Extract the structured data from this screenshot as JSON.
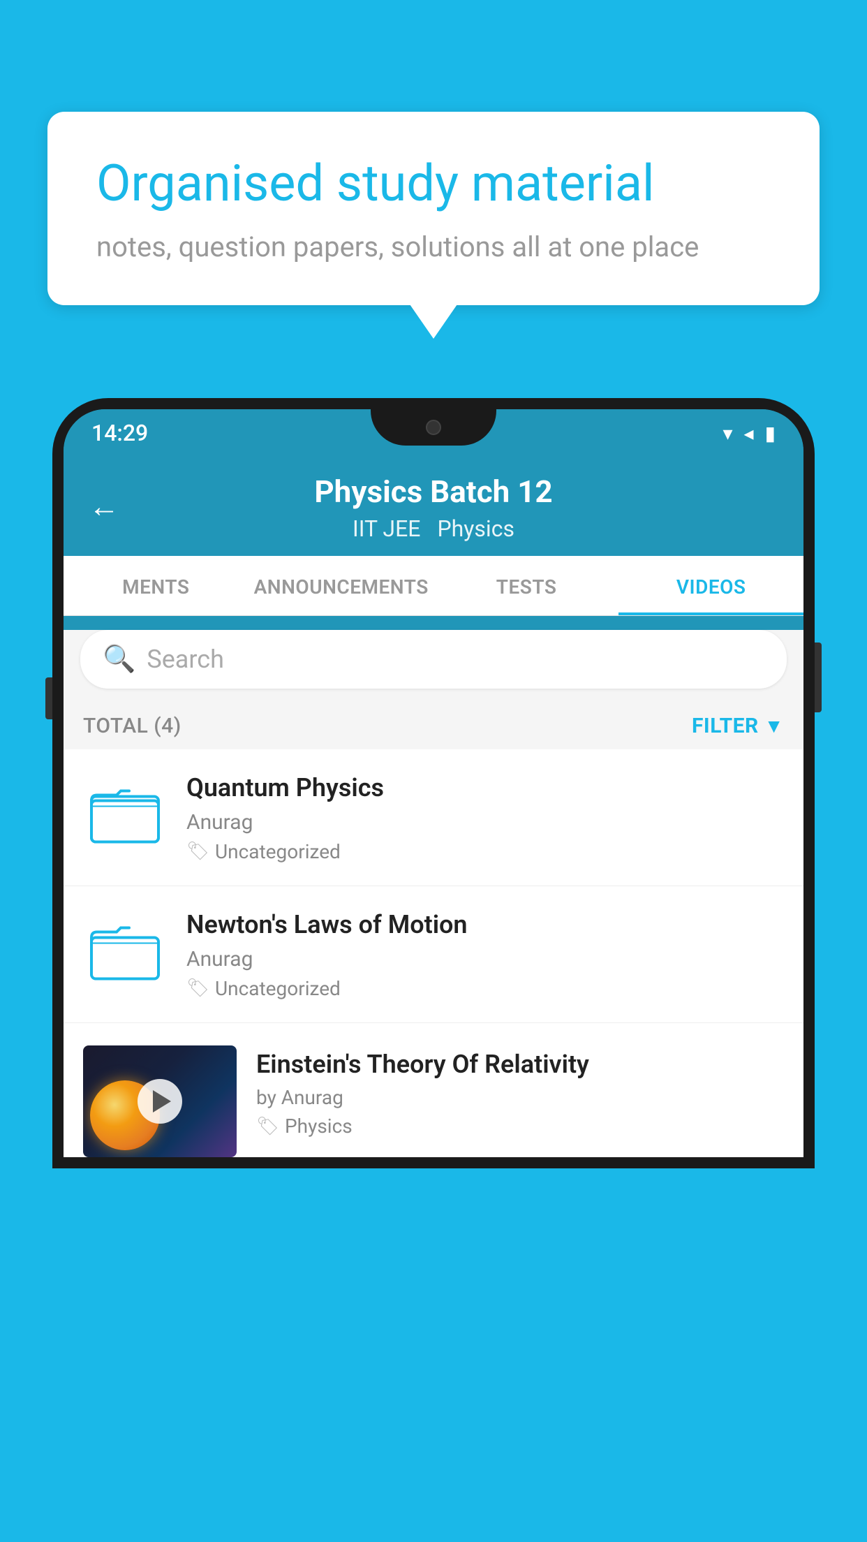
{
  "background": {
    "color": "#1ab8e8"
  },
  "bubble": {
    "title": "Organised study material",
    "subtitle": "notes, question papers, solutions all at one place"
  },
  "status_bar": {
    "time": "14:29",
    "icons": [
      "wifi",
      "signal",
      "battery"
    ]
  },
  "header": {
    "title": "Physics Batch 12",
    "tag1": "IIT JEE",
    "tag2": "Physics",
    "back_label": "←"
  },
  "tabs": [
    {
      "label": "MENTS",
      "active": false
    },
    {
      "label": "ANNOUNCEMENTS",
      "active": false
    },
    {
      "label": "TESTS",
      "active": false
    },
    {
      "label": "VIDEOS",
      "active": true
    }
  ],
  "search": {
    "placeholder": "Search"
  },
  "filter_row": {
    "total": "TOTAL (4)",
    "filter_label": "FILTER"
  },
  "videos": [
    {
      "title": "Quantum Physics",
      "author": "Anurag",
      "tag": "Uncategorized",
      "has_thumbnail": false
    },
    {
      "title": "Newton's Laws of Motion",
      "author": "Anurag",
      "tag": "Uncategorized",
      "has_thumbnail": false
    },
    {
      "title": "Einstein's Theory Of Relativity",
      "author": "by Anurag",
      "tag": "Physics",
      "has_thumbnail": true
    }
  ],
  "icons": {
    "folder": "folder",
    "tag": "🏷",
    "filter": "▼",
    "back": "←"
  }
}
